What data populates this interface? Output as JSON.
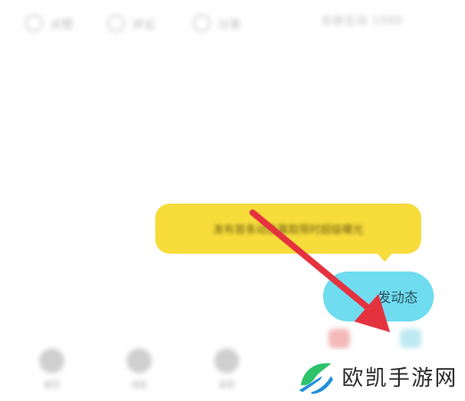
{
  "top_bar": {
    "actions": [
      {
        "label": "点赞",
        "icon": "like-icon"
      },
      {
        "label": "评论",
        "icon": "comment-icon"
      },
      {
        "label": "分享",
        "icon": "share-icon"
      }
    ],
    "right_text": "全部互动 1000"
  },
  "hint": {
    "text": "发布首条动态赢取限时超级曝光"
  },
  "fab": {
    "label": "发动态",
    "color": "#6fdcf0"
  },
  "tabbar": {
    "items": [
      {
        "label": "首页",
        "icon": "home-icon"
      },
      {
        "label": "消息",
        "icon": "message-icon"
      },
      {
        "label": "发现",
        "icon": "discover-icon"
      }
    ]
  },
  "watermark": {
    "text": "欧凯手游网",
    "logo": "leaf-logo-icon",
    "logo_colors": [
      "#2ec26b",
      "#1f8fd9"
    ]
  },
  "annotation": {
    "arrow_color": "#e5323f"
  }
}
